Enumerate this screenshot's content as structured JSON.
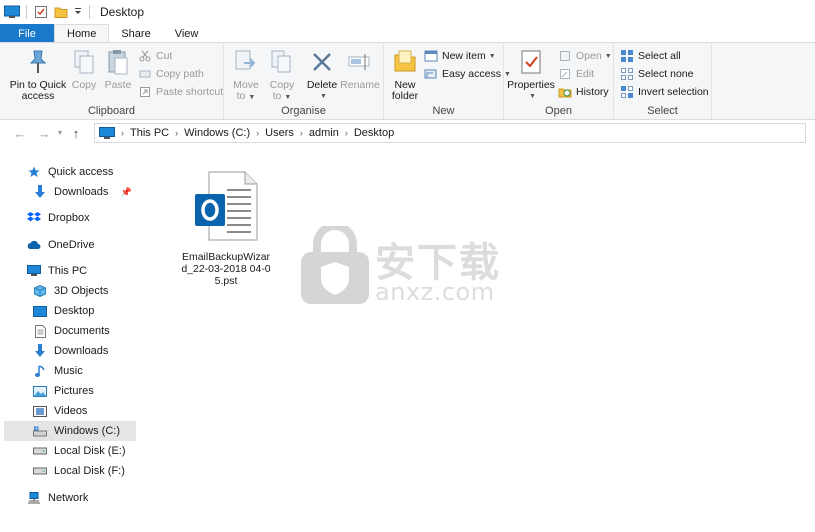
{
  "window": {
    "title": "Desktop"
  },
  "tabs": [
    {
      "label": "File"
    },
    {
      "label": "Home"
    },
    {
      "label": "Share"
    },
    {
      "label": "View"
    }
  ],
  "ribbon": {
    "clipboard": {
      "label": "Clipboard",
      "pin_line1": "Pin to Quick",
      "pin_line2": "access",
      "copy": "Copy",
      "paste": "Paste",
      "cut": "Cut",
      "copy_path": "Copy path",
      "paste_shortcut": "Paste shortcut"
    },
    "organise": {
      "label": "Organise",
      "move_line1": "Move",
      "move_line2": "to",
      "copy_line1": "Copy",
      "copy_line2": "to",
      "delete": "Delete",
      "rename": "Rename"
    },
    "new": {
      "label": "New",
      "folder_line1": "New",
      "folder_line2": "folder",
      "new_item": "New item",
      "easy_access": "Easy access"
    },
    "open": {
      "label": "Open",
      "properties": "Properties",
      "open": "Open",
      "edit": "Edit",
      "history": "History"
    },
    "select": {
      "label": "Select",
      "select_all": "Select all",
      "select_none": "Select none",
      "invert_selection": "Invert selection"
    }
  },
  "address": {
    "crumbs": [
      "This PC",
      "Windows (C:)",
      "Users",
      "admin",
      "Desktop"
    ]
  },
  "nav": {
    "quick_access": "Quick access",
    "downloads_pinned": "Downloads",
    "dropbox": "Dropbox",
    "onedrive": "OneDrive",
    "this_pc": "This PC",
    "objects3d": "3D Objects",
    "desktop": "Desktop",
    "documents": "Documents",
    "downloads": "Downloads",
    "music": "Music",
    "pictures": "Pictures",
    "videos": "Videos",
    "windows_c": "Windows (C:)",
    "local_e": "Local Disk (E:)",
    "local_f": "Local Disk (F:)",
    "network": "Network"
  },
  "files": [
    {
      "name": "EmailBackupWizard_22-03-2018 04-05.pst",
      "icon": "outlook-pst-icon"
    }
  ],
  "watermark": {
    "site": "anxz.com",
    "cn": "安下载"
  },
  "colors": {
    "file_tab": "#1979ca",
    "ribbon_bg": "#f5f6f7",
    "selected_nav": "#e5e5e5",
    "outlook_blue": "#0a64ad"
  }
}
